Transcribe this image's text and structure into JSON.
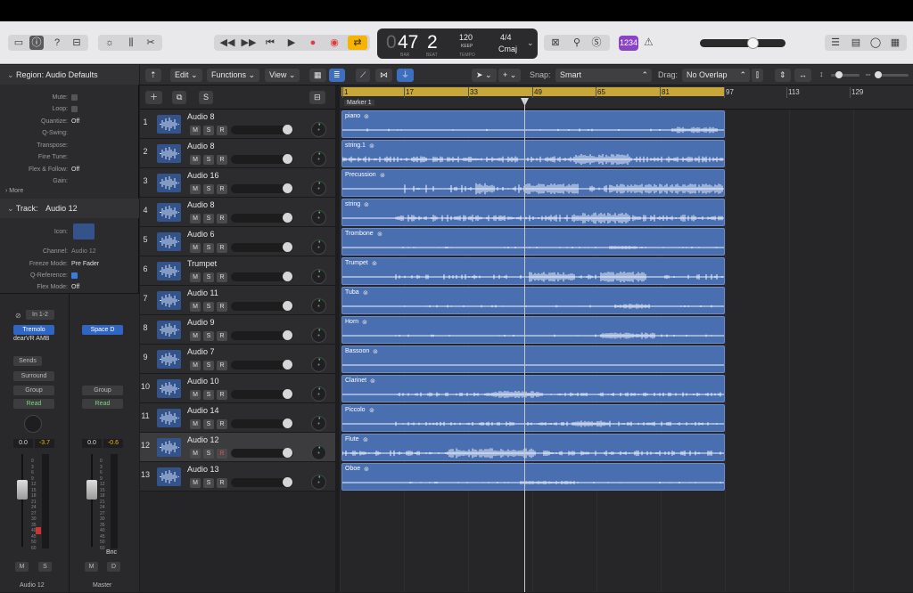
{
  "toolbar": {
    "lcd": {
      "bar_value": "47",
      "beat_value": "2",
      "bar_label": "BAR",
      "beat_label": "BEAT",
      "tempo_value": "120",
      "tempo_mode": "KEEP",
      "tempo_label": "TEMPO",
      "signature": "4/4",
      "key": "Cmaj"
    },
    "badge": "1234",
    "master_volume_level": 0.65
  },
  "inspector": {
    "region_header": "Region: Audio Defaults",
    "region_params": [
      {
        "label": "Mute:",
        "value": ""
      },
      {
        "label": "Loop:",
        "value": ""
      },
      {
        "label": "Quantize:",
        "value": "Off"
      },
      {
        "label": "Q-Swing:",
        "value": ""
      },
      {
        "label": "Transpose:",
        "value": ""
      },
      {
        "label": "Fine Tune:",
        "value": ""
      },
      {
        "label": "Flex & Follow:",
        "value": "Off"
      },
      {
        "label": "Gain:",
        "value": ""
      }
    ],
    "more_label": "More",
    "track_header": "Track:",
    "track_name": "Audio 12",
    "track_params": [
      {
        "label": "Icon:",
        "value": ""
      },
      {
        "label": "Channel:",
        "value": "Audio 12"
      },
      {
        "label": "Freeze Mode:",
        "value": "Pre Fader"
      },
      {
        "label": "Q-Reference:",
        "value": ""
      },
      {
        "label": "Flex Mode:",
        "value": "Off"
      }
    ],
    "strip_left": {
      "input": "In 1-2",
      "plugin1": "Tremolo",
      "plugin2": "dearVR AMB",
      "sends": "Sends",
      "output": "Surround",
      "group": "Group",
      "automation": "Read",
      "pan_value": "0.0",
      "peak_value": "-3.7",
      "name": "Audio 12"
    },
    "strip_right": {
      "plugin1": "Space D",
      "group": "Group",
      "automation": "Read",
      "pan_value": "0.0",
      "peak_value": "-0.6",
      "bounce": "Bnc",
      "name": "Master"
    },
    "scale": [
      "0",
      "3",
      "6",
      "9",
      "12",
      "15",
      "18",
      "21",
      "24",
      "27",
      "30",
      "35",
      "40",
      "45",
      "50",
      "60"
    ]
  },
  "localbar": {
    "edit": "Edit",
    "functions": "Functions",
    "view": "View",
    "snap_label": "Snap:",
    "snap_value": "Smart",
    "drag_label": "Drag:",
    "drag_value": "No Overlap"
  },
  "ruler": {
    "labels": [
      "1",
      "17",
      "33",
      "49",
      "65",
      "81",
      "97",
      "113",
      "129"
    ],
    "marker": "Marker 1"
  },
  "tracks": [
    {
      "num": "1",
      "name": "Audio 8",
      "region": "piano"
    },
    {
      "num": "2",
      "name": "Audio 8",
      "region": "string.1"
    },
    {
      "num": "3",
      "name": "Audio 16",
      "region": "Precussion"
    },
    {
      "num": "4",
      "name": "Audio 8",
      "region": "string"
    },
    {
      "num": "5",
      "name": "Audio 6",
      "region": "Trombone"
    },
    {
      "num": "6",
      "name": "Trumpet",
      "region": "Trumpet"
    },
    {
      "num": "7",
      "name": "Audio 11",
      "region": "Tuba"
    },
    {
      "num": "8",
      "name": "Audio 9",
      "region": "Horn"
    },
    {
      "num": "9",
      "name": "Audio 7",
      "region": "Bassoon"
    },
    {
      "num": "10",
      "name": "Audio 10",
      "region": "Clarinet"
    },
    {
      "num": "11",
      "name": "Audio 14",
      "region": "Piccolo"
    },
    {
      "num": "12",
      "name": "Audio 12",
      "region": "Flute"
    },
    {
      "num": "13",
      "name": "Audio 13",
      "region": "Oboe"
    }
  ],
  "msr": {
    "m": "M",
    "s": "S",
    "r": "R"
  },
  "colors": {
    "region": "#4a6fb0",
    "cycle": "#c7a63a",
    "accent": "#f4b400",
    "selected_track": "#3c3c3f"
  }
}
